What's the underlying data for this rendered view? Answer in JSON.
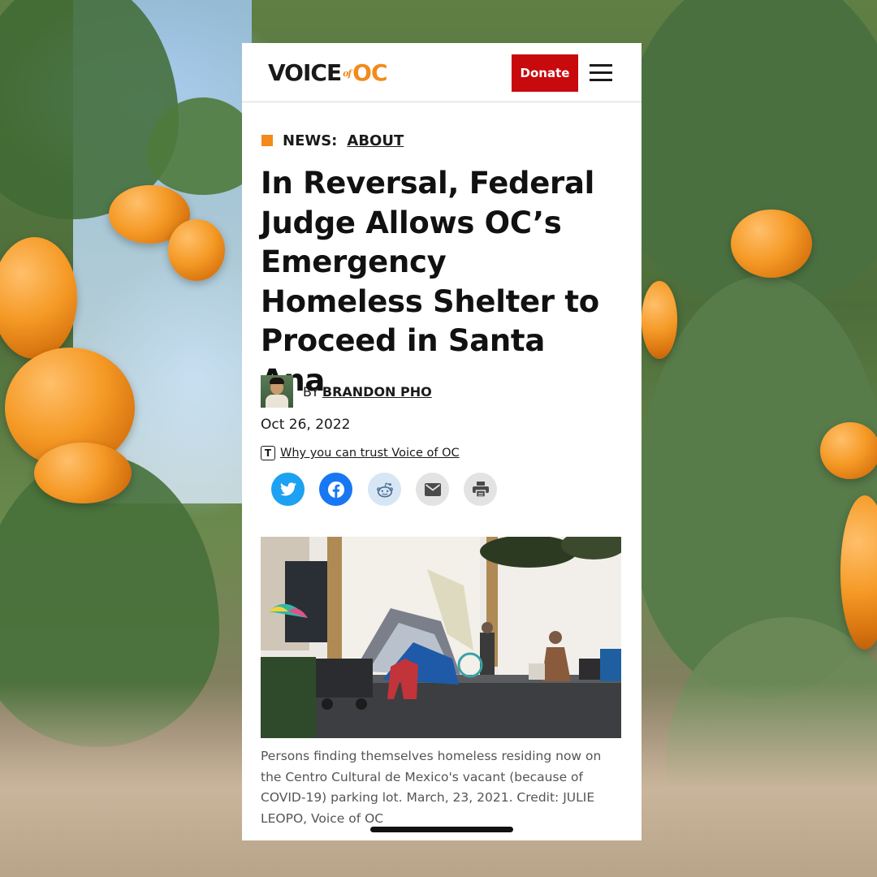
{
  "header": {
    "logo": {
      "voice": "VOICE",
      "of": "of",
      "oc": "OC"
    },
    "donate_label": "Donate",
    "menu_icon": "hamburger-icon"
  },
  "article": {
    "kicker": {
      "section": "NEWS:",
      "category": "ABOUT"
    },
    "headline": "In Reversal, Federal Judge Allows OC’s Emergency Homeless Shelter to Proceed in Santa Ana",
    "byline": {
      "by": "BY",
      "author": "BRANDON PHO"
    },
    "date": "Oct 26, 2022",
    "trust_link": "Why you can trust Voice of OC",
    "share_buttons": [
      {
        "name": "twitter",
        "icon": "twitter-icon",
        "color": "#1da1f2"
      },
      {
        "name": "facebook",
        "icon": "facebook-icon",
        "color": "#1877f2"
      },
      {
        "name": "reddit",
        "icon": "reddit-icon",
        "color": "#d6e6f5"
      },
      {
        "name": "email",
        "icon": "email-icon",
        "color": "#e3e3e3"
      },
      {
        "name": "print",
        "icon": "print-icon",
        "color": "#e3e3e3"
      }
    ],
    "caption": "Persons finding themselves homeless residing now on the Centro Cultural de Mexico's vacant (because of COVID-19) parking lot. March, 23, 2021. Credit: JULIE LEOPO, Voice of OC"
  },
  "colors": {
    "accent": "#f28a1c",
    "donate": "#c8090d",
    "text": "#111111"
  }
}
